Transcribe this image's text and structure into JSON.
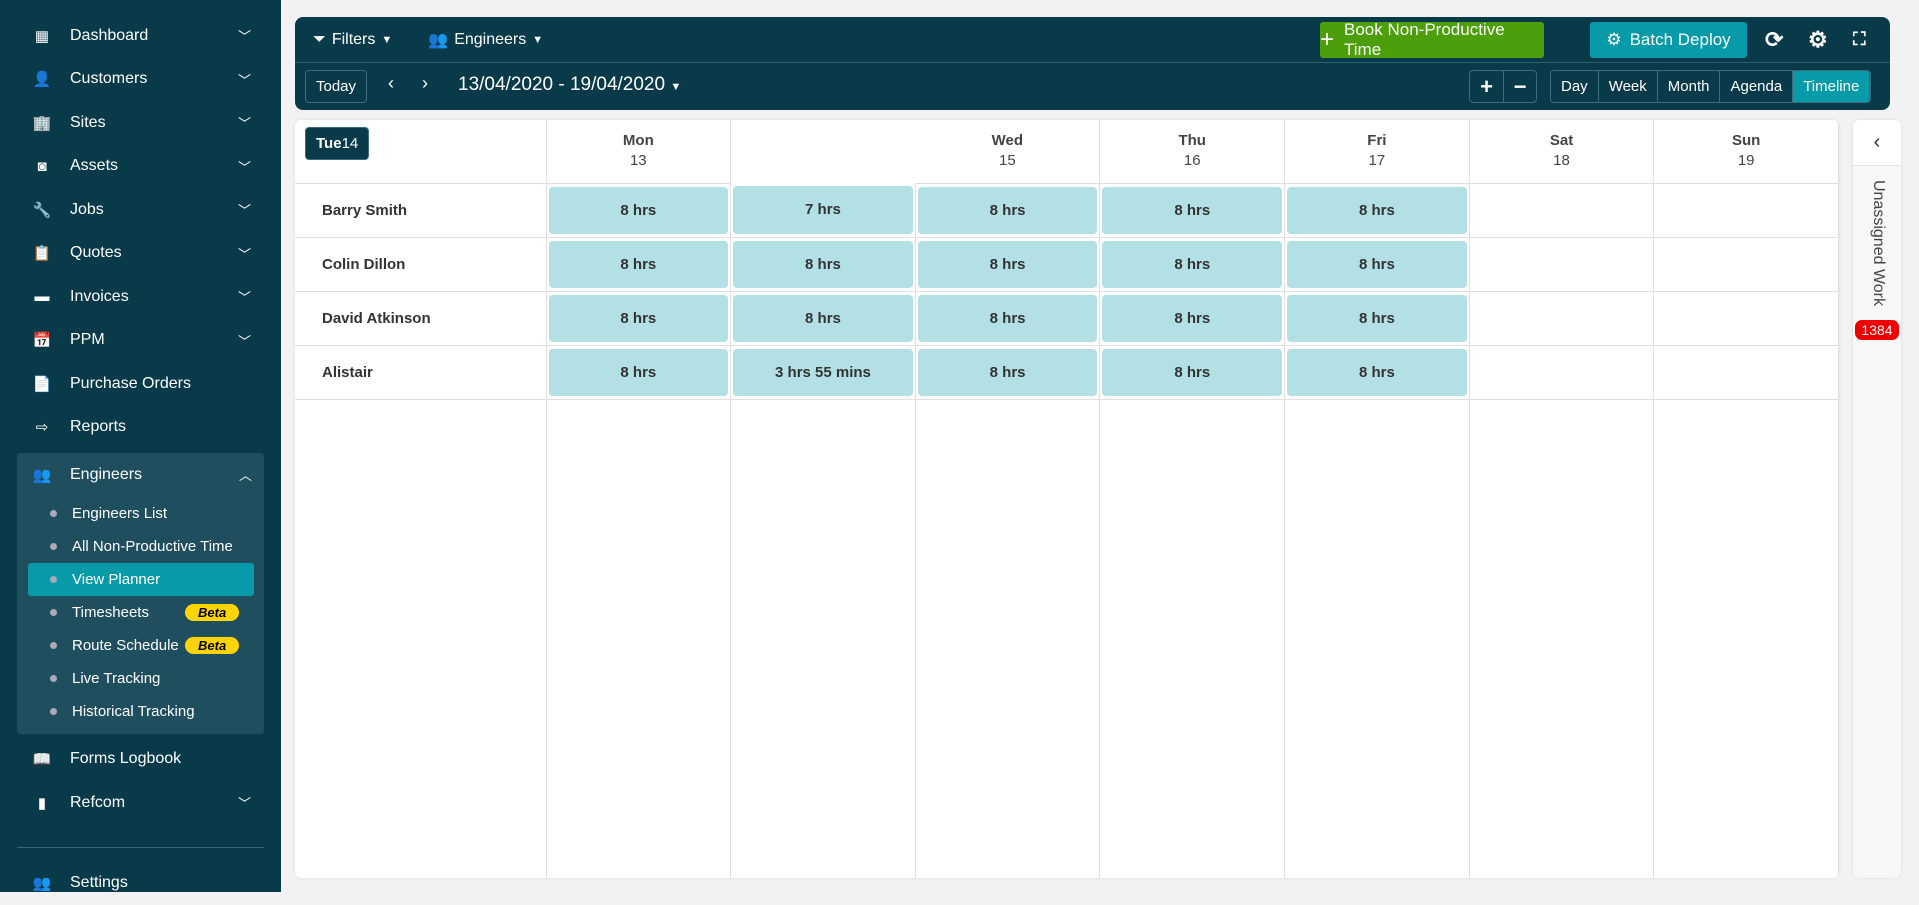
{
  "sidebar": {
    "items": [
      {
        "label": "Dashboard",
        "icon": "dashboard-icon",
        "glyph": "▦",
        "chevron": true
      },
      {
        "label": "Customers",
        "icon": "user-icon",
        "glyph": "👤",
        "chevron": true
      },
      {
        "label": "Sites",
        "icon": "building-icon",
        "glyph": "🏢",
        "chevron": true
      },
      {
        "label": "Assets",
        "icon": "asset-icon",
        "glyph": "◙",
        "chevron": true
      },
      {
        "label": "Jobs",
        "icon": "wrench-icon",
        "glyph": "🔧",
        "chevron": true
      },
      {
        "label": "Quotes",
        "icon": "clipboard-icon",
        "glyph": "📋",
        "chevron": true
      },
      {
        "label": "Invoices",
        "icon": "credit-card-icon",
        "glyph": "▬",
        "chevron": true
      },
      {
        "label": "PPM",
        "icon": "calendar-check-icon",
        "glyph": "📅",
        "chevron": true
      },
      {
        "label": "Purchase Orders",
        "icon": "document-icon",
        "glyph": "📄",
        "chevron": false
      },
      {
        "label": "Reports",
        "icon": "export-icon",
        "glyph": "⇨",
        "chevron": false
      }
    ],
    "engineers": {
      "label": "Engineers",
      "subitems": [
        {
          "label": "Engineers List"
        },
        {
          "label": "All Non-Productive Time"
        },
        {
          "label": "View Planner",
          "active": true
        },
        {
          "label": "Timesheets",
          "badge": "Beta"
        },
        {
          "label": "Route Schedule",
          "badge": "Beta"
        },
        {
          "label": "Live Tracking"
        },
        {
          "label": "Historical Tracking"
        }
      ]
    },
    "after": [
      {
        "label": "Forms Logbook"
      },
      {
        "label": "Refcom"
      }
    ],
    "settings": "Settings"
  },
  "toolbar": {
    "filters": "Filters",
    "engineers": "Engineers",
    "book_npt": "Book Non-Productive Time",
    "batch_deploy": "Batch Deploy",
    "today": "Today",
    "date_range": "13/04/2020 - 19/04/2020",
    "views": [
      "Day",
      "Week",
      "Month",
      "Agenda",
      "Timeline"
    ],
    "active_view": "Timeline"
  },
  "planner": {
    "days": [
      {
        "d": "Mon",
        "n": "13"
      },
      {
        "d": "Tue",
        "n": "14",
        "today": true
      },
      {
        "d": "Wed",
        "n": "15"
      },
      {
        "d": "Thu",
        "n": "16"
      },
      {
        "d": "Fri",
        "n": "17"
      },
      {
        "d": "Sat",
        "n": "18"
      },
      {
        "d": "Sun",
        "n": "19"
      }
    ],
    "rows": [
      {
        "name": "Barry Smith",
        "hours": [
          "8 hrs",
          "7 hrs",
          "8 hrs",
          "8 hrs",
          "8 hrs",
          "",
          ""
        ]
      },
      {
        "name": "Colin Dillon",
        "hours": [
          "8 hrs",
          "8 hrs",
          "8 hrs",
          "8 hrs",
          "8 hrs",
          "",
          ""
        ]
      },
      {
        "name": "David Atkinson",
        "hours": [
          "8 hrs",
          "8 hrs",
          "8 hrs",
          "8 hrs",
          "8 hrs",
          "",
          ""
        ]
      },
      {
        "name": "Alistair",
        "hours": [
          "8 hrs",
          "3 hrs 55 mins",
          "8 hrs",
          "8 hrs",
          "8 hrs",
          "",
          ""
        ]
      }
    ]
  },
  "unassigned": {
    "label": "Unassigned Work",
    "count": "1384"
  },
  "colors": {
    "sidebar": "#083a4a",
    "accent": "#079aa8",
    "green": "#4c9e0a",
    "block": "#b3e0e5",
    "badge": "#e00000",
    "beta": "#ffd400"
  }
}
